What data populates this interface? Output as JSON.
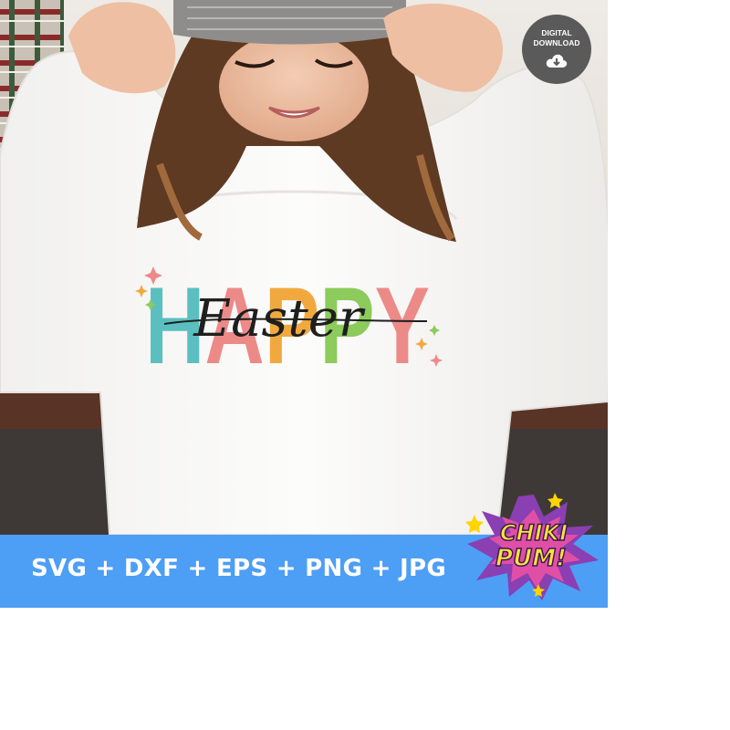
{
  "badge": {
    "line1": "DIGITAL",
    "line2": "DOWNLOAD",
    "icon": "cloud-download-icon"
  },
  "design": {
    "main_word": "HAPPY",
    "script_word": "Easter",
    "letter_colors": [
      "#5bbfbf",
      "#ec8a88",
      "#f1a93f",
      "#8ccb5c",
      "#ec8a88"
    ]
  },
  "banner": {
    "formats": "SVG + DXF + EPS + PNG + JPG",
    "color": "#4d9ef5"
  },
  "logo": {
    "line1": "CHIKI",
    "line2": "PUM!"
  }
}
